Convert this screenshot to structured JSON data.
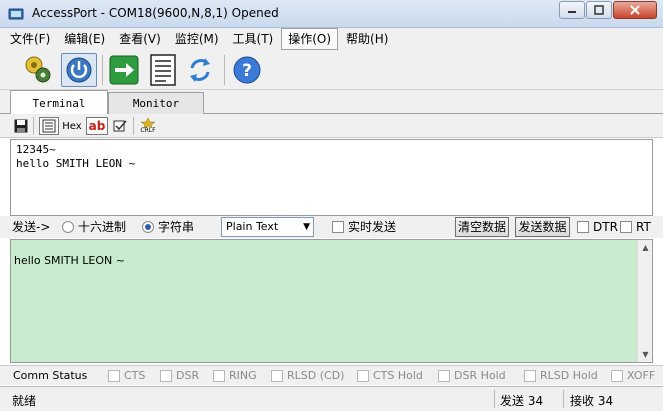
{
  "window": {
    "title": "AccessPort - COM18(9600,N,8,1) Opened"
  },
  "menu": {
    "items": [
      {
        "label": "文件(F)"
      },
      {
        "label": "编辑(E)"
      },
      {
        "label": "查看(V)"
      },
      {
        "label": "监控(M)"
      },
      {
        "label": "工具(T)"
      },
      {
        "label": "操作(O)"
      },
      {
        "label": "帮助(H)"
      }
    ],
    "active_index": 5
  },
  "toolbar": {
    "icons": [
      "settings-gear-icon",
      "power-icon",
      "forward-arrow-icon",
      "document-icon",
      "refresh-icon",
      "help-icon"
    ]
  },
  "tabs": [
    {
      "label": "Terminal",
      "active": true
    },
    {
      "label": "Monitor",
      "active": false
    }
  ],
  "toolbar2": {
    "hex_label": "Hex",
    "ab_label": "ab",
    "crlf_label": "CRLF"
  },
  "receive": {
    "lines": [
      "12345~",
      "hello SMITH LEON ~"
    ]
  },
  "sendbar": {
    "send_label": "发送->",
    "hex_option": "十六进制",
    "string_option": "字符串",
    "selected": "string",
    "format_value": "Plain Text",
    "realtime_label": "实时发送",
    "clear_button": "清空数据",
    "send_button": "发送数据",
    "dtr_label": "DTR",
    "rts_label": "RT"
  },
  "send_area": {
    "text": "hello SMITH LEON ~"
  },
  "comm_status": {
    "label": "Comm Status",
    "flags": [
      "CTS",
      "DSR",
      "RING",
      "RLSD (CD)",
      "CTS Hold",
      "DSR Hold",
      "RLSD Hold",
      "XOFF"
    ]
  },
  "statusbar": {
    "state": "就绪",
    "sent": "发送 34",
    "received": "接收 34"
  },
  "colors": {
    "send_area_bg": "#c7ebcc",
    "title_bg": "#dfe9f5"
  }
}
